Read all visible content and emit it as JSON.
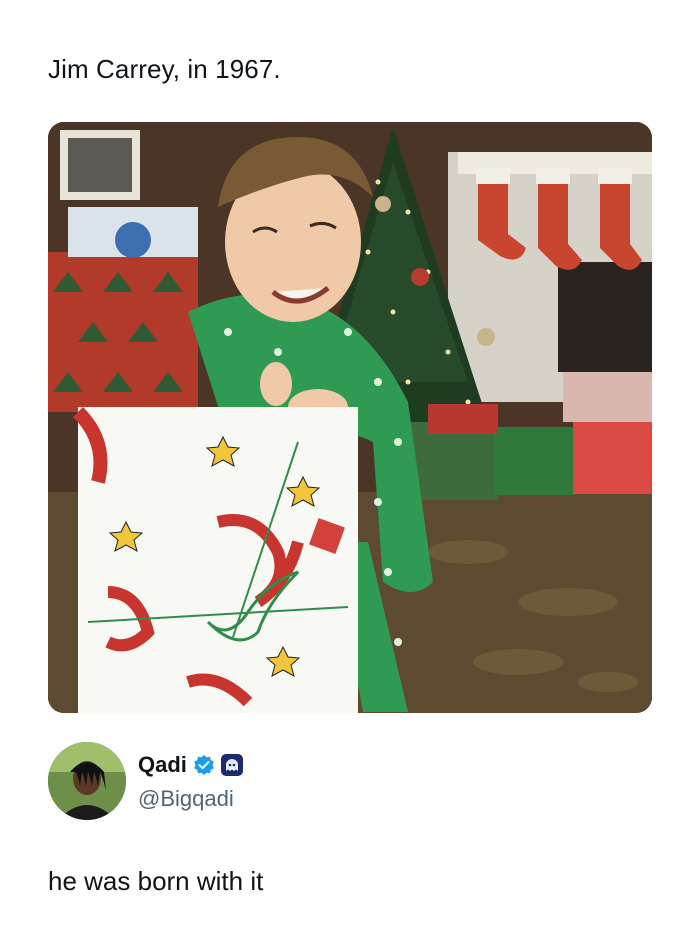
{
  "post": {
    "text": "Jim Carrey, in 1967."
  },
  "photo": {
    "icon": "photo-christmas-boy"
  },
  "author": {
    "display_name": "Qadi",
    "handle": "@Bigqadi",
    "verified": true,
    "verified_color": "#1d9bf0",
    "affiliate_badge_color": "#1d2a6e"
  },
  "reply": {
    "text": "he was born with it"
  }
}
